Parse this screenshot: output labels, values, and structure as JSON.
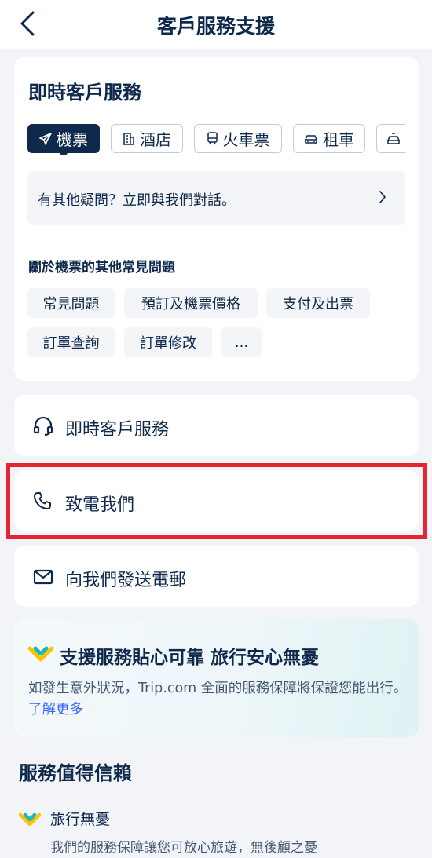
{
  "header": {
    "title": "客戶服務支援"
  },
  "live_card": {
    "heading": "即時客戶服務",
    "tabs": [
      {
        "label": "機票",
        "icon": "plane-icon",
        "active": true
      },
      {
        "label": "酒店",
        "icon": "hotel-icon",
        "active": false
      },
      {
        "label": "火車票",
        "icon": "train-icon",
        "active": false
      },
      {
        "label": "租車",
        "icon": "car-icon",
        "active": false
      },
      {
        "label": "",
        "icon": "taxi-icon",
        "active": false
      }
    ],
    "chat_prompt": "有其他疑問？立即與我們對話。",
    "faq_title": "關於機票的其他常見問題",
    "faq_chips": [
      "常見問題",
      "預訂及機票價格",
      "支付及出票",
      "訂單查詢",
      "訂單修改",
      "..."
    ]
  },
  "contact_rows": [
    {
      "label": "即時客戶服務",
      "icon": "headset-icon"
    },
    {
      "label": "致電我們",
      "icon": "phone-icon"
    },
    {
      "label": "向我們發送電郵",
      "icon": "mail-icon"
    }
  ],
  "guarantee": {
    "title": "支援服務貼心可靠 旅行安心無憂",
    "description": "如發生意外狀況，Trip.com 全面的服務保障將保證您能出行。",
    "link": "了解更多"
  },
  "trust": {
    "title": "服務值得信賴",
    "item_title": "旅行無憂",
    "item_desc": "我們的服務保障讓您可放心旅遊，無後顧之憂"
  },
  "colors": {
    "primary": "#0f294d",
    "highlight": "#e52631",
    "link": "#3264ff",
    "brand_yellow": "#ffc400",
    "brand_teal": "#1fb8b8"
  }
}
